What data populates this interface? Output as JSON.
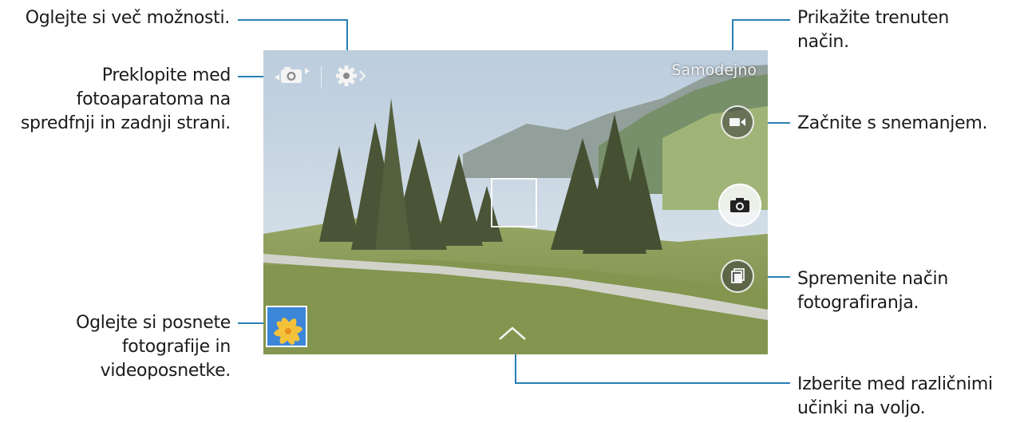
{
  "camera": {
    "mode_label": "Samodejno"
  },
  "callouts": {
    "more_options": "Oglejte si več možnosti.",
    "switch_camera": [
      "Preklopite med",
      "fotoaparatoma na",
      "spredfnji in zadnji strani."
    ],
    "view_media": [
      "Oglejte si posnete",
      "fotografije in",
      "videoposnetke."
    ],
    "current_mode": [
      "Prikažite trenuten",
      "način."
    ],
    "start_recording": "Začnite s snemanjem.",
    "change_shooting_mode": [
      "Spremenite način",
      "fotografiranja."
    ],
    "choose_effects": [
      "Izberite med različnimi",
      "učinki na voljo."
    ]
  },
  "icons": {
    "switch_camera": "camera-switch-icon",
    "settings": "gear-icon",
    "record": "video-camera-icon",
    "shutter": "camera-icon",
    "shooting_mode": "stacked-frames-icon",
    "gallery": "gallery-thumbnail-icon",
    "effects": "chevron-up-icon"
  },
  "colors": {
    "callout_line": "#2a7fb3"
  }
}
